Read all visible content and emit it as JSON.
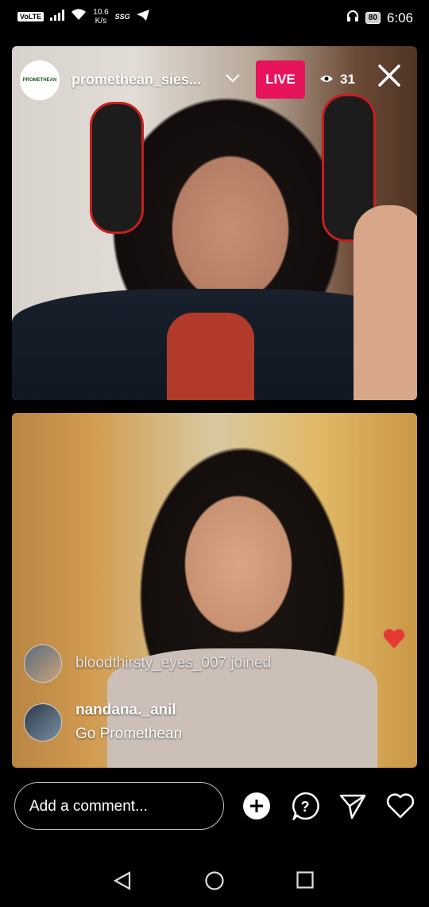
{
  "statusbar": {
    "volte": "VoLTE",
    "net_speed_value": "10.6",
    "net_speed_unit": "K/s",
    "ssg": "SSG",
    "battery": "80",
    "time": "6:06"
  },
  "live": {
    "host_username": "promethean_sies...",
    "host_avatar_text": "PROMETHEAN",
    "live_label": "LIVE",
    "viewer_count": "31"
  },
  "comments": {
    "join_event": "bloodthirsty_eyes_007 joined",
    "message_user": "nandana._anil",
    "message_text": "Go Promethean"
  },
  "bottom": {
    "comment_placeholder": "Add a comment..."
  },
  "colors": {
    "live_badge": "#e8135d",
    "floating_heart": "#e53935"
  },
  "icons": [
    "wifi-icon",
    "signal-icon",
    "telegram-icon",
    "headset-icon",
    "eye-icon",
    "close-icon",
    "add-icon",
    "question-icon",
    "send-icon",
    "heart-icon",
    "back-icon",
    "home-icon",
    "recents-icon"
  ]
}
